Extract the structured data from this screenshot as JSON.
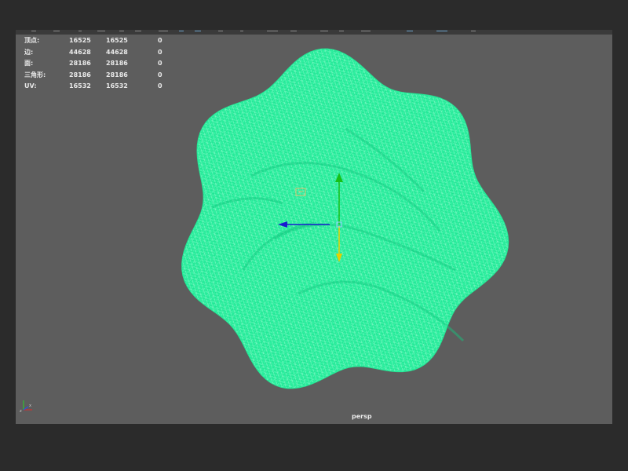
{
  "hud": {
    "rows": [
      {
        "label": "顶点:",
        "c1": "16525",
        "c2": "16525",
        "c3": "0"
      },
      {
        "label": "边:",
        "c1": "44628",
        "c2": "44628",
        "c3": "0"
      },
      {
        "label": "面:",
        "c1": "28186",
        "c2": "28186",
        "c3": "0"
      },
      {
        "label": "三角形:",
        "c1": "28186",
        "c2": "28186",
        "c3": "0"
      },
      {
        "label": "UV:",
        "c1": "16532",
        "c2": "16532",
        "c3": "0"
      }
    ]
  },
  "viewport": {
    "camera": "persp"
  },
  "colors": {
    "viewport_bg": "#5d5d5d",
    "mesh_wire": "#22ff9a",
    "mesh_fill": "#6bf0b0",
    "gizmo_x": "#1a1ad0",
    "gizmo_y": "#18c018",
    "gizmo_z": "#e6d000",
    "pivot": "#e0c070"
  },
  "icons": {
    "manipulator": "move-manipulator-icon",
    "axis": "view-axis-icon"
  }
}
